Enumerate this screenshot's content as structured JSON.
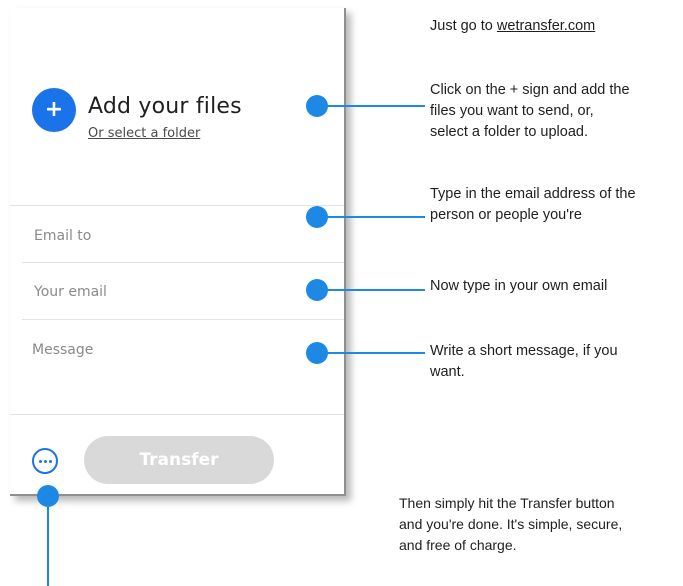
{
  "panel": {
    "add_title": "Add your files",
    "add_folder_link": "Or select a folder",
    "email_to_placeholder": "Email to",
    "your_email_placeholder": "Your email",
    "message_placeholder": "Message",
    "transfer_label": "Transfer",
    "plus_glyph": "+",
    "icons": [
      "plus-icon",
      "more-options-icon"
    ],
    "colors": {
      "accent": "#1a73e8",
      "callout": "#1e88e5",
      "transfer_disabled": "#d9d9d9"
    }
  },
  "notes": {
    "step1_prefix": "Just go to ",
    "step1_link": "wetransfer.com",
    "step2_lines": [
      "Click on the + sign and add the",
      "files you want to send, or,",
      "select a folder to upload."
    ],
    "step3_lines": [
      "Type in the email address of the",
      "person or people you're"
    ],
    "step4_lines": [
      "Now type in your own email"
    ],
    "step5_lines": [
      "Write a short message, if you",
      "want."
    ],
    "step6_lines": [
      "Then simply hit the Transfer button",
      "and you're done. It's simple, secure,",
      "and free of charge."
    ]
  }
}
